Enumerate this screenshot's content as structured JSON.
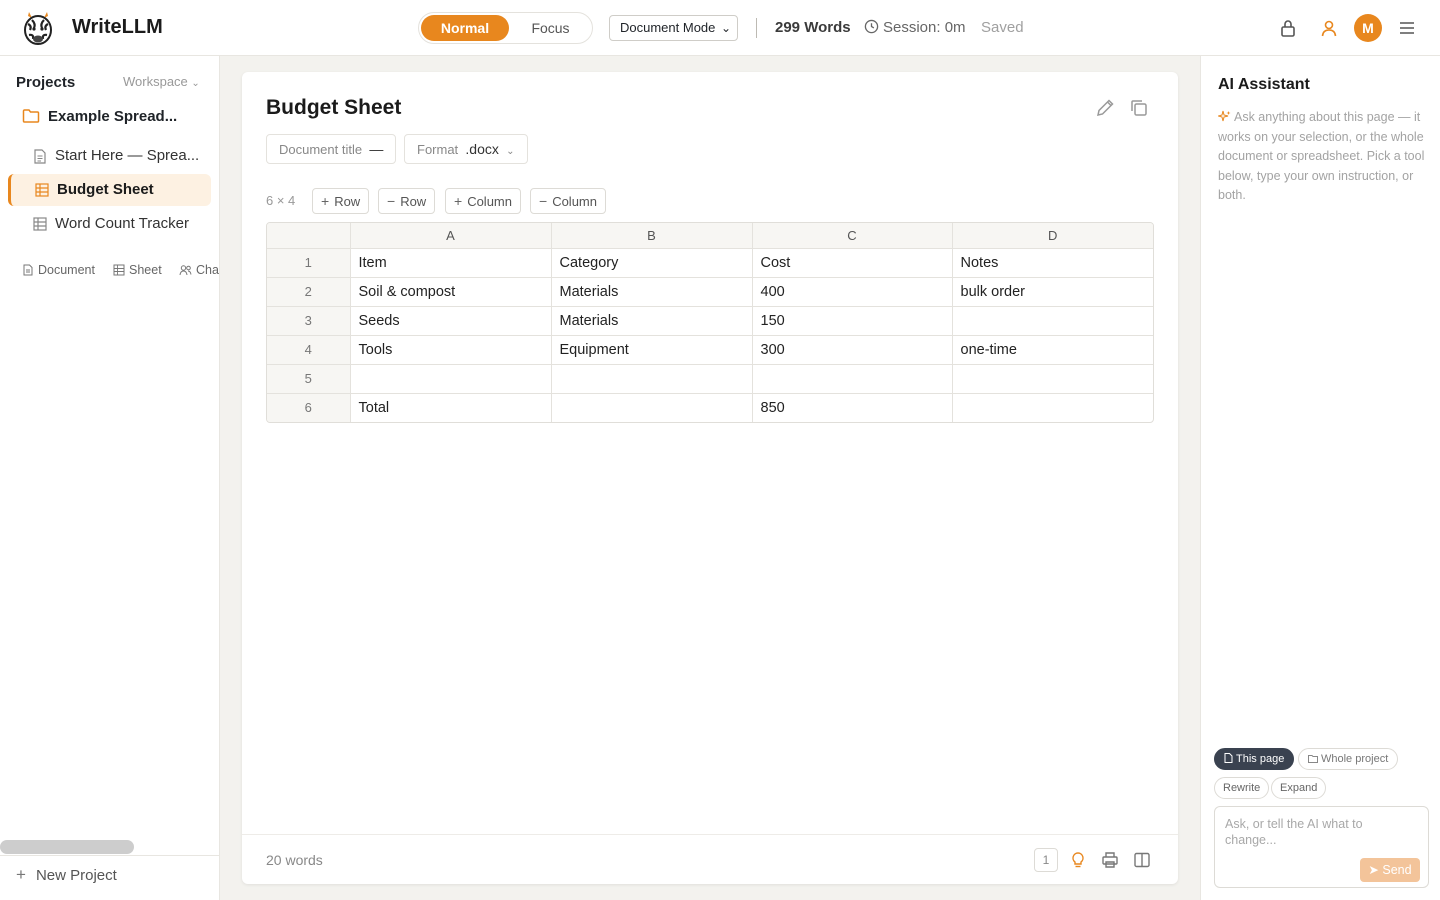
{
  "app": {
    "name": "WriteLLM"
  },
  "header": {
    "modes": [
      "Normal",
      "Focus"
    ],
    "active_mode": "Normal",
    "document_mode": "Document Mode",
    "word_count": "299 Words",
    "session": "Session: 0m",
    "save_status": "Saved",
    "avatar_initial": "M",
    "accent_color": "#e8871e"
  },
  "sidebar": {
    "title": "Projects",
    "workspace_label": "Workspace",
    "project_name": "Example Spread...",
    "pages": [
      {
        "label": "Start Here — Sprea...",
        "icon": "document-icon",
        "active": false
      },
      {
        "label": "Budget Sheet",
        "icon": "sheet-icon",
        "active": true
      },
      {
        "label": "Word Count Tracker",
        "icon": "sheet-icon",
        "active": false
      }
    ],
    "new_types": [
      "Document",
      "Sheet",
      "Cha"
    ],
    "new_project": "New Project"
  },
  "document": {
    "title": "Budget Sheet",
    "title_chip_label": "Document title",
    "title_chip_value": "—",
    "format_label": "Format",
    "format_value": ".docx",
    "dims": "6 × 4",
    "toolbar": {
      "add_row": "Row",
      "remove_row": "Row",
      "add_column": "Column",
      "remove_column": "Column"
    },
    "columns": [
      "A",
      "B",
      "C",
      "D"
    ],
    "rows": [
      {
        "num": "1",
        "cells": [
          "Item",
          "Category",
          "Cost",
          "Notes"
        ]
      },
      {
        "num": "2",
        "cells": [
          "Soil & compost",
          "Materials",
          "400",
          "bulk order"
        ]
      },
      {
        "num": "3",
        "cells": [
          "Seeds",
          "Materials",
          "150",
          ""
        ]
      },
      {
        "num": "4",
        "cells": [
          "Tools",
          "Equipment",
          "300",
          "one-time"
        ]
      },
      {
        "num": "5",
        "cells": [
          "",
          "",
          "",
          ""
        ]
      },
      {
        "num": "6",
        "cells": [
          "Total",
          "",
          "850",
          ""
        ]
      }
    ],
    "footer_words": "20 words",
    "page_number": "1"
  },
  "ai": {
    "title": "AI Assistant",
    "description": "Ask anything about this page — it works on your selection, or the whole document or spreadsheet. Pick a tool below, type your own instruction, or both.",
    "scopes": [
      "This page",
      "Whole project"
    ],
    "tools": [
      "Rewrite",
      "Expand"
    ],
    "input_placeholder": "Ask, or tell the AI what to change...",
    "send_label": "Send"
  }
}
